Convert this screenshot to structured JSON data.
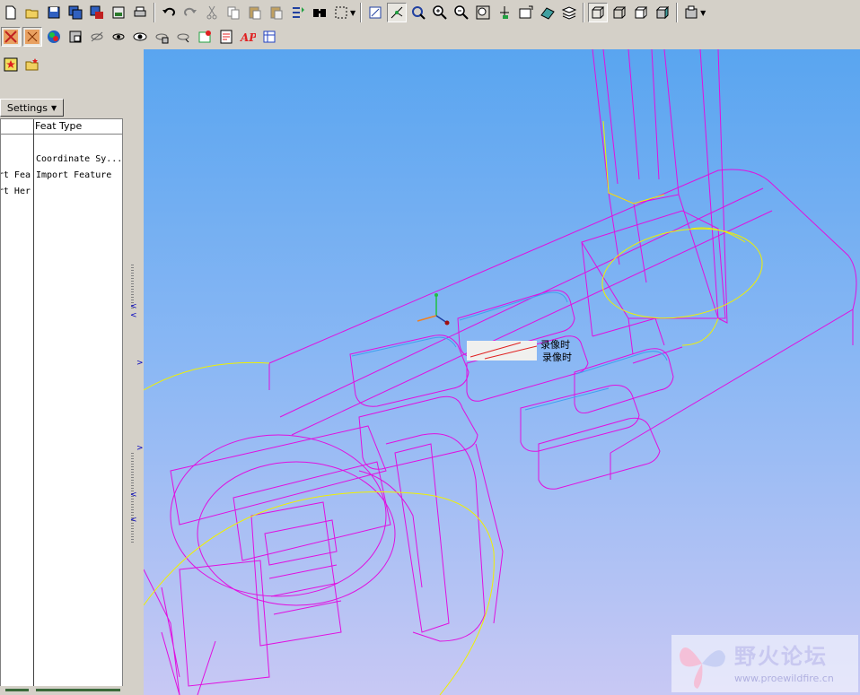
{
  "toolbar_main": [
    {
      "name": "new-icon"
    },
    {
      "name": "open-icon"
    },
    {
      "name": "save-icon"
    },
    {
      "name": "save-copy-icon"
    },
    {
      "name": "backup-icon"
    },
    {
      "name": "rename-icon"
    },
    {
      "name": "print-icon"
    },
    {
      "name": "undo-icon"
    },
    {
      "name": "redo-icon"
    },
    {
      "name": "cut-icon"
    },
    {
      "name": "copy-icon"
    },
    {
      "name": "paste-icon"
    },
    {
      "name": "paste-special-icon"
    },
    {
      "name": "regenerate-icon"
    },
    {
      "name": "find-icon"
    },
    {
      "name": "select-box-icon"
    },
    {
      "name": "spin-center-icon"
    },
    {
      "name": "orient-mode-icon"
    },
    {
      "name": "view-manager-icon"
    },
    {
      "name": "zoom-in-icon"
    },
    {
      "name": "zoom-out-icon"
    },
    {
      "name": "refit-icon"
    },
    {
      "name": "reorient-icon"
    },
    {
      "name": "saved-views-icon"
    },
    {
      "name": "model-display-icon"
    },
    {
      "name": "layers-icon"
    },
    {
      "name": "wireframe-icon"
    },
    {
      "name": "hidden-line-icon"
    },
    {
      "name": "no-hidden-icon"
    },
    {
      "name": "shading-icon"
    },
    {
      "name": "datum-display-icon"
    }
  ],
  "toolbar_datum": [
    {
      "name": "datum-planes-icon"
    },
    {
      "name": "datum-axes-icon"
    },
    {
      "name": "color-appearance-icon"
    },
    {
      "name": "datum-points-icon"
    },
    {
      "name": "hide-icon"
    },
    {
      "name": "show-icon"
    },
    {
      "name": "eye-icon"
    },
    {
      "name": "coord-sys-icon"
    },
    {
      "name": "spin-icon"
    },
    {
      "name": "annotation-icon"
    },
    {
      "name": "note-icon"
    },
    {
      "name": "ap-icon"
    },
    {
      "name": "table-icon"
    }
  ],
  "tree": {
    "settings_label": "Settings",
    "column_feat_type": "Feat Type",
    "rows": [
      {
        "name": "",
        "type": "Coordinate Sy..."
      },
      {
        "name": "rt Fea",
        "type": "Import Feature"
      },
      {
        "name": "rt Her",
        "type": ""
      }
    ]
  },
  "viewport": {
    "tooltip_line1": "录像时",
    "tooltip_line2": "录像时"
  },
  "watermark": {
    "title": "野火论坛",
    "url": "www.proewildfire.cn"
  }
}
